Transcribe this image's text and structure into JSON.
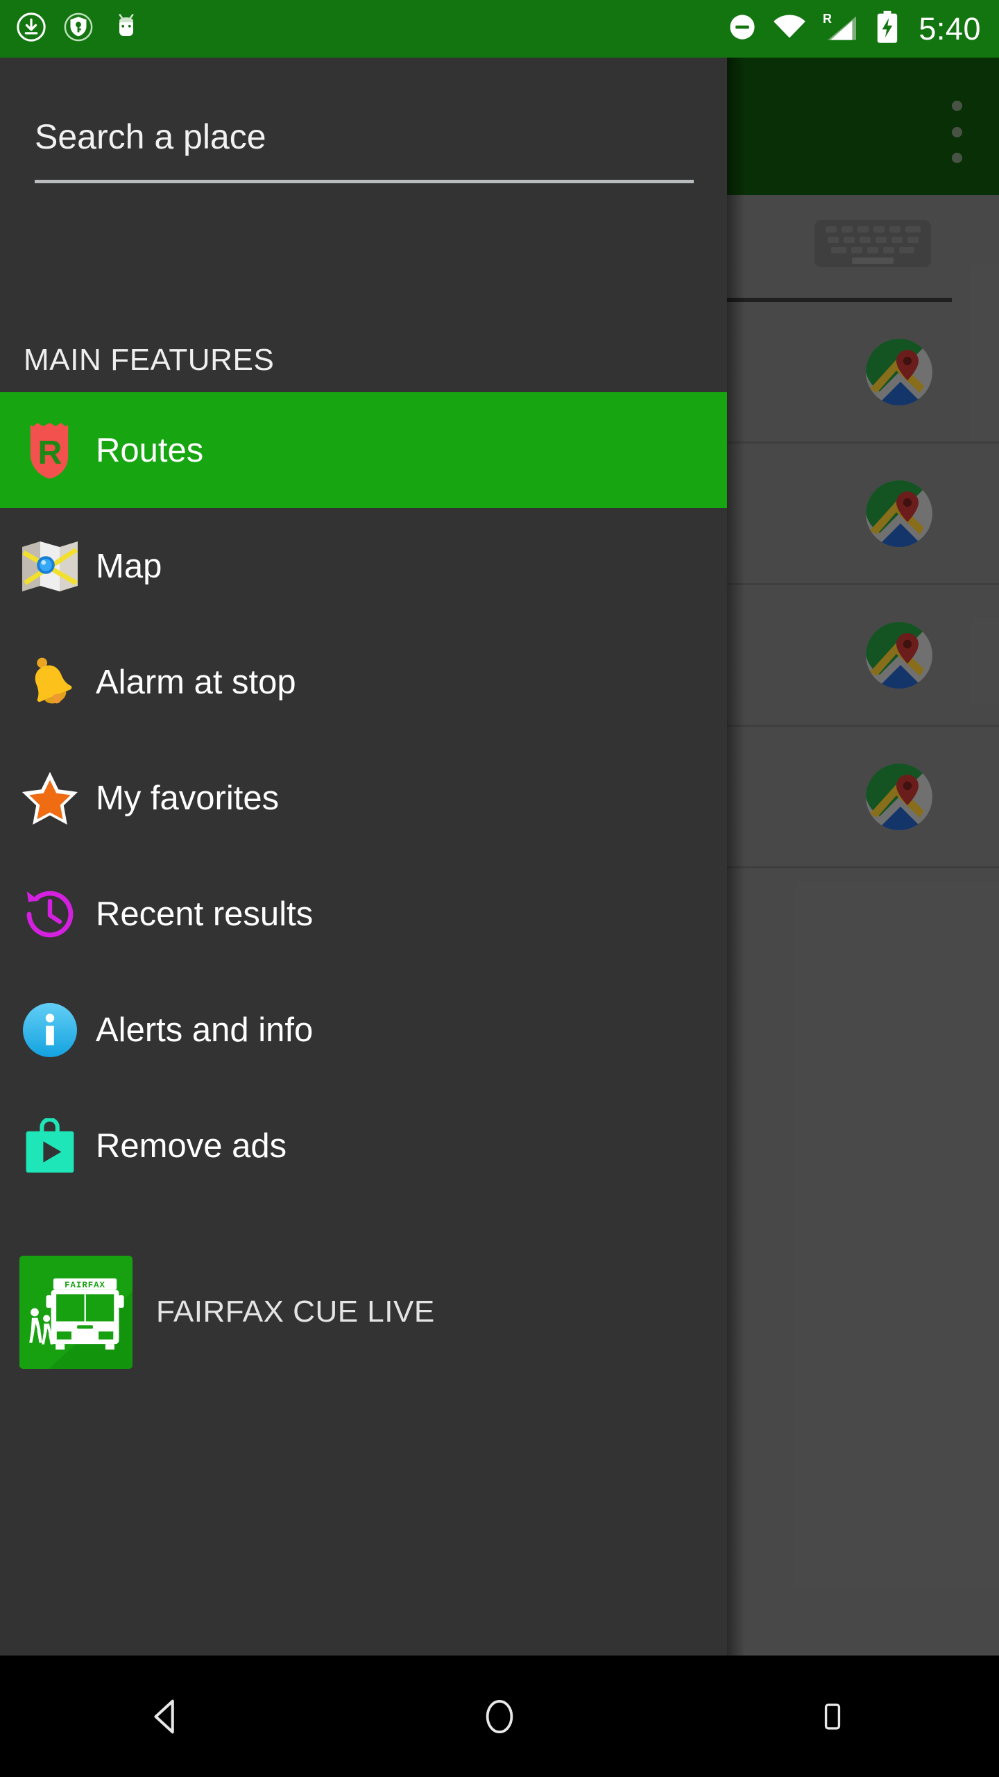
{
  "status_bar": {
    "background_color": "#12750f",
    "time": "5:40",
    "left_icons": [
      {
        "name": "download-icon",
        "label": "Download"
      },
      {
        "name": "vpn-key-shield-icon",
        "label": "VPN"
      },
      {
        "name": "android-head-icon",
        "label": "Android"
      }
    ],
    "right_icons": [
      {
        "name": "do-not-disturb-icon",
        "label": "Do not disturb"
      },
      {
        "name": "wifi-icon",
        "label": "Wi-Fi"
      },
      {
        "name": "cellular-signal-roaming-icon",
        "label": "R",
        "roaming_label": "R"
      },
      {
        "name": "battery-charging-icon",
        "label": "Charging"
      }
    ]
  },
  "app": {
    "toolbar": {
      "background_color": "#0c4608",
      "overflow_label": "More options"
    },
    "keyboard_hint": "keyboard-icon",
    "results": [
      {
        "icon": "google-maps-icon"
      },
      {
        "icon": "google-maps-icon"
      },
      {
        "icon": "google-maps-icon"
      },
      {
        "icon": "google-maps-icon"
      }
    ]
  },
  "drawer": {
    "background_color": "#333333",
    "search": {
      "placeholder": "Search a place",
      "value": ""
    },
    "section_header": "MAIN FEATURES",
    "highlight_color": "#17a611",
    "items": [
      {
        "label": "Routes",
        "icon": "routes-shield-icon",
        "active": true
      },
      {
        "label": "Map",
        "icon": "folded-map-icon",
        "active": false
      },
      {
        "label": "Alarm at stop",
        "icon": "bell-icon",
        "active": false
      },
      {
        "label": "My favorites",
        "icon": "star-icon",
        "active": false
      },
      {
        "label": "Recent results",
        "icon": "history-clock-icon",
        "active": false
      },
      {
        "label": "Alerts and info",
        "icon": "info-circle-icon",
        "active": false
      },
      {
        "label": "Remove ads",
        "icon": "play-store-bag-icon",
        "active": false
      }
    ],
    "brand": {
      "label": "FAIRFAX CUE LIVE",
      "icon": "fairfax-bus-app-icon",
      "bus_sign_text": "FAIRFAX"
    }
  },
  "nav_bar": {
    "background_color": "#000000",
    "buttons": [
      {
        "name": "back-button",
        "label": "Back"
      },
      {
        "name": "home-button",
        "label": "Home"
      },
      {
        "name": "recents-button",
        "label": "Recent apps"
      }
    ]
  }
}
